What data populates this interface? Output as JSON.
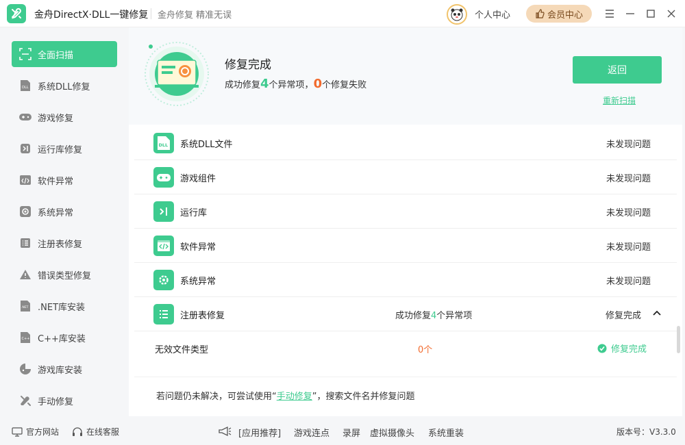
{
  "window": {
    "title": "金舟DirectX·DLL一键修复",
    "slogan": "金舟修复 精准无误",
    "personal_center": "个人中心",
    "vip_center": "会员中心"
  },
  "sidebar": {
    "items": [
      {
        "label": "全面扫描",
        "icon": "scan-icon",
        "active": true
      },
      {
        "label": "系统DLL修复",
        "icon": "dll-icon"
      },
      {
        "label": "游戏修复",
        "icon": "gamepad-icon"
      },
      {
        "label": "运行库修复",
        "icon": "runtime-icon"
      },
      {
        "label": "软件异常",
        "icon": "code-window-icon"
      },
      {
        "label": "系统异常",
        "icon": "gear-icon"
      },
      {
        "label": "注册表修复",
        "icon": "list-icon"
      },
      {
        "label": "错误类型修复",
        "icon": "warning-icon"
      },
      {
        "label": ".NET库安装",
        "icon": "dotnet-icon"
      },
      {
        "label": "C++库安装",
        "icon": "cpp-icon"
      },
      {
        "label": "游戏库安装",
        "icon": "game-lib-icon"
      },
      {
        "label": "手动修复",
        "icon": "wrench-icon"
      }
    ]
  },
  "status": {
    "title": "修复完成",
    "line_prefix": "成功修复",
    "fixed_count": "4",
    "line_mid": "个异常项，",
    "failed_count": "0",
    "line_suffix": "个修复失败",
    "back_button": "返回",
    "rescan_link": "重新扫描"
  },
  "results": [
    {
      "label": "系统DLL文件",
      "icon": "dll-file-icon",
      "status": "未发现问题"
    },
    {
      "label": "游戏组件",
      "icon": "gamepad-icon",
      "status": "未发现问题"
    },
    {
      "label": "运行库",
      "icon": "runtime-icon",
      "status": "未发现问题"
    },
    {
      "label": "软件异常",
      "icon": "code-window-icon",
      "status": "未发现问题"
    },
    {
      "label": "系统异常",
      "icon": "gear-icon",
      "status": "未发现问题"
    },
    {
      "label": "注册表修复",
      "icon": "list-icon",
      "middle_prefix": "成功修复",
      "middle_count": "4",
      "middle_suffix": "个异常项",
      "status": "修复完成"
    }
  ],
  "registry_details": [
    {
      "label": "无效文件类型",
      "count": "0个",
      "status": "修复完成"
    }
  ],
  "hint": {
    "prefix": "若问题仍未解决，可尝试使用“",
    "link": "手动修复",
    "suffix": "”，搜索文件名并修复问题"
  },
  "footer": {
    "website": "官方网站",
    "service": "在线客服",
    "recommend_label": "[应用推荐]",
    "recommend_items": [
      "游戏连点",
      "录屏",
      "虚拟摄像头",
      "系统重装"
    ],
    "version": "版本号：V3.3.0"
  },
  "colors": {
    "accent": "#3ecb8f",
    "danger": "#f26b2e",
    "vip_bg": "#f5d9b8"
  }
}
